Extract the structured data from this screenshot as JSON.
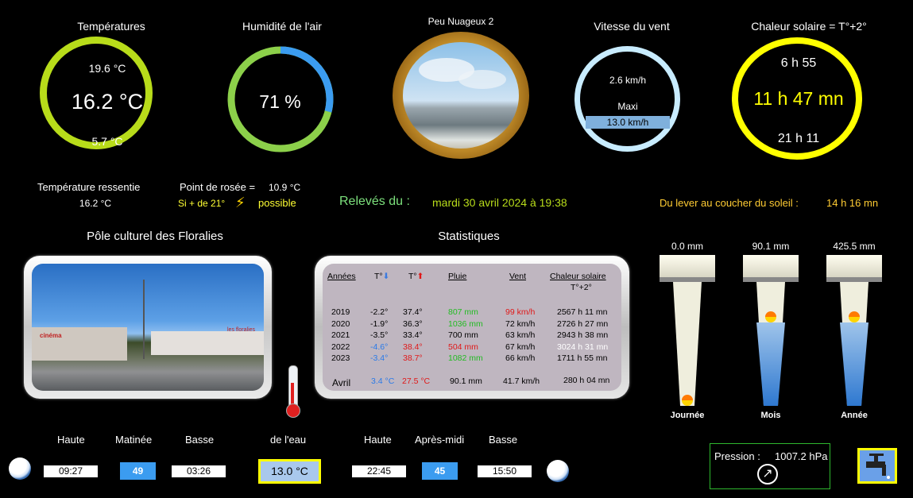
{
  "temperatures": {
    "title": "Températures",
    "max": "19.6 °C",
    "current": "16.2 °C",
    "min": "5.7 °C"
  },
  "humidity": {
    "title": "Humidité de l'air",
    "value": "71 %",
    "percent": 71
  },
  "sky": {
    "title": "Peu Nuageux 2"
  },
  "wind": {
    "title": "Vitesse du vent",
    "current": "2.6 km/h",
    "max_label": "Maxi",
    "max_value": "13.0  km/h"
  },
  "sun": {
    "title": "Chaleur solaire = T°+2°",
    "sunrise": "6 h 55",
    "duration": "11 h 47 mn",
    "sunset": "21 h 11"
  },
  "felt": {
    "label": "Température ressentie",
    "value": "16.2 °C"
  },
  "dew": {
    "label": "Point de rosée =",
    "value": "10.9 °C",
    "hint": "Si + de 21°",
    "hint2": "possible"
  },
  "readings": {
    "label": "Relevés du :",
    "datetime": "mardi 30 avril 2024 à 19:38"
  },
  "daylight": {
    "label": "Du lever au coucher du soleil :",
    "value": "14 h 16 mn"
  },
  "photo": {
    "title": "Pôle culturel des Floralies",
    "sign1": "cinéma",
    "sign2": "les floralies"
  },
  "stats": {
    "title": "Statistiques",
    "headers": [
      "Années",
      "T°",
      "T°",
      "Pluie",
      "Vent",
      "Chaleur solaire"
    ],
    "subheader": "T°+2°",
    "rows": [
      {
        "year": "2019",
        "tmin": "-2.2°",
        "tmax": "37.4°",
        "rain": "807 mm",
        "wind": "99 km/h",
        "sun": "2567 h 11 mn"
      },
      {
        "year": "2020",
        "tmin": "-1.9°",
        "tmax": "36.3°",
        "rain": "1036 mm",
        "wind": "72 km/h",
        "sun": "2726 h 27 mn"
      },
      {
        "year": "2021",
        "tmin": "-3.5°",
        "tmax": "33.4°",
        "rain": "700 mm",
        "wind": "63 km/h",
        "sun": "2943 h 38 mn"
      },
      {
        "year": "2022",
        "tmin": "-4.6°",
        "tmax": "38.4°",
        "rain": "504 mm",
        "wind": "67 km/h",
        "sun": "3024 h 31 mn"
      },
      {
        "year": "2023",
        "tmin": "-3.4°",
        "tmax": "38.7°",
        "rain": "1082 mm",
        "wind": "66 km/h",
        "sun": "1711 h 55 mn"
      }
    ],
    "month": {
      "label": "Avril",
      "tmin": "3.4 °C",
      "tmax": "27.5 °C",
      "rain": "90.1 mm",
      "wind": "41.7 km/h",
      "sun": "280 h 04 mn"
    }
  },
  "rain": {
    "day": {
      "value": "0.0 mm",
      "label": "Journée",
      "fill": 0.0
    },
    "month": {
      "value": "90.1 mm",
      "label": "Mois",
      "fill": 0.55
    },
    "year": {
      "value": "425.5  mm",
      "label": "Année",
      "fill": 0.55
    }
  },
  "tides": {
    "morning": {
      "high_label": "Haute",
      "coef_label": "Matinée",
      "low_label": "Basse",
      "high": "09:27",
      "coef": "49",
      "low": "03:26"
    },
    "water": {
      "label": "de l'eau",
      "value": "13.0 °C"
    },
    "afternoon": {
      "high_label": "Haute",
      "coef_label": "Après-midi",
      "low_label": "Basse",
      "high": "22:45",
      "coef": "45",
      "low": "15:50"
    }
  },
  "pressure": {
    "label": "Pression :",
    "value": "1007.2  hPa",
    "trend_icon": "arrow-up-right-icon"
  },
  "colors": {
    "green": "#b8dc1a",
    "yellow": "#ffff00",
    "lightblue": "#c8ecff",
    "accent_blue": "#3b9cf0"
  }
}
